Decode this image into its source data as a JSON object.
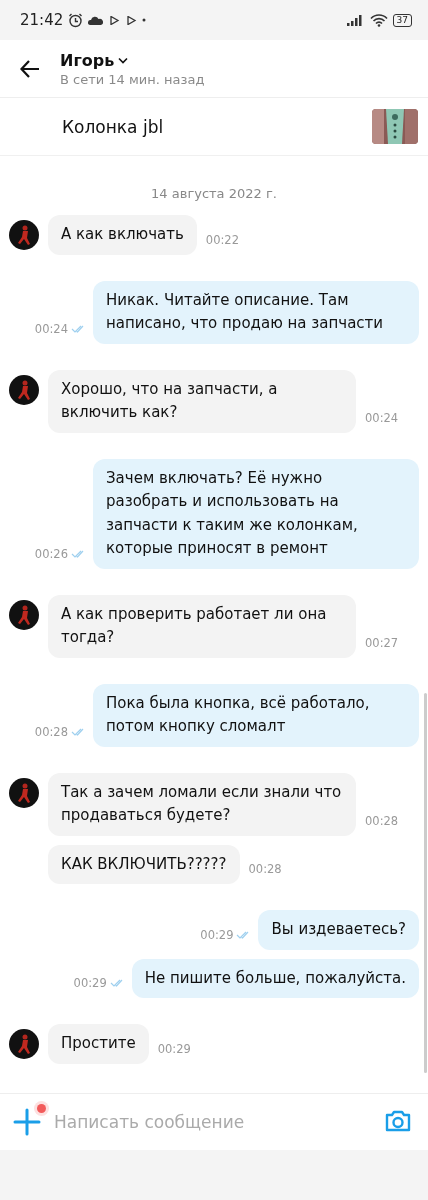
{
  "status_bar": {
    "time": "21:42",
    "battery": "37"
  },
  "header": {
    "name": "Игорь",
    "presence": "В сети 14 мин. назад"
  },
  "listing": {
    "title": "Колонка jbl"
  },
  "date": "14 августа 2022 г.",
  "messages": [
    {
      "kind": "incoming",
      "avatar": true,
      "text": "А как включать",
      "time": "00:22"
    },
    {
      "kind": "outgoing",
      "read": true,
      "text": "Никак. Читайте описание. Там написано, что продаю на запчасти",
      "time": "00:24"
    },
    {
      "kind": "incoming",
      "avatar": true,
      "text": "Хорошо, что на запчасти, а включить как?",
      "time": "00:24"
    },
    {
      "kind": "outgoing",
      "read": true,
      "text": "Зачем включать? Её нужно разобрать и использовать на запчасти к таким же колонкам, которые приносят в ремонт",
      "time": "00:26"
    },
    {
      "kind": "incoming",
      "avatar": true,
      "text": "А как проверить работает ли она тогда?",
      "time": "00:27"
    },
    {
      "kind": "outgoing",
      "read": true,
      "text": "Пока была кнопка, всё работало, потом кнопку сломалт",
      "time": "00:28"
    },
    {
      "kind": "incoming",
      "avatar": true,
      "text": "Так а зачем ломали если знали что продаваться будете?",
      "time": "00:28"
    },
    {
      "kind": "incoming",
      "avatar": false,
      "text": "КАК ВКЛЮЧИТЬ?????",
      "time": "00:28"
    },
    {
      "kind": "outgoing",
      "read": true,
      "text": "Вы издеваетесь?",
      "time": "00:29"
    },
    {
      "kind": "outgoing",
      "read": true,
      "text": "Не пишите больше, пожалуйста.",
      "time": "00:29"
    },
    {
      "kind": "incoming",
      "avatar": true,
      "text": "Простите",
      "time": "00:29"
    }
  ],
  "composer": {
    "placeholder": "Написать сообщение",
    "attach_badge": true
  }
}
